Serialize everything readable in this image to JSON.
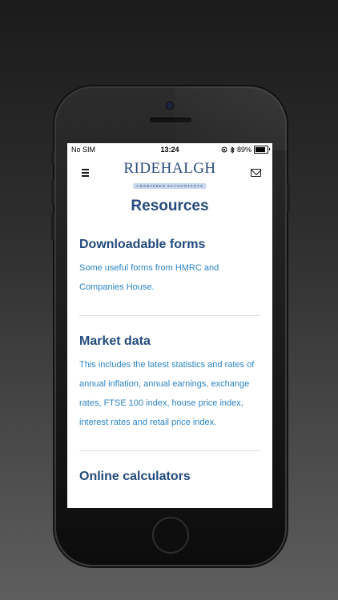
{
  "status_bar": {
    "carrier": "No SIM",
    "time": "13:24",
    "battery_percent": "89%",
    "battery_level": 0.89
  },
  "header": {
    "logo_name": "RIDEHALGH",
    "logo_subtitle": "CHARTERED ACCOUNTANTS"
  },
  "page": {
    "title": "Resources"
  },
  "sections": [
    {
      "title": "Downloadable forms",
      "description": "Some useful forms from HMRC and Companies House."
    },
    {
      "title": "Market data",
      "description": "This includes the latest statistics and rates of annual inflation, annual earnings, exchange rates, FTSE 100 index, house price index, interest rates and retail price index."
    },
    {
      "title": "Online calculators"
    }
  ],
  "colors": {
    "heading": "#234a7c",
    "link_text": "#2b85c4",
    "logo": "#2a4a7a"
  }
}
